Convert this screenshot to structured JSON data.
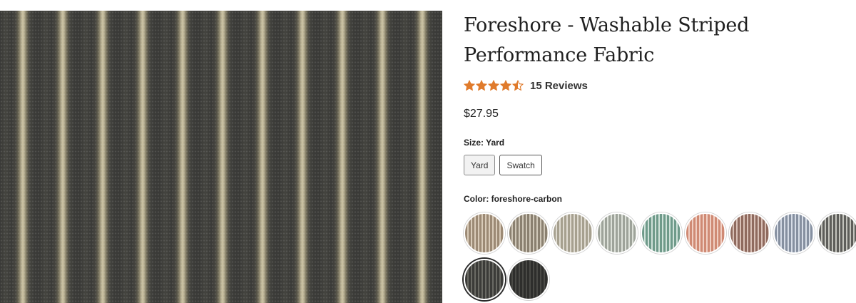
{
  "product": {
    "title": "Foreshore - Washable Striped Performance Fabric",
    "rating": 4.5,
    "reviews_label": "15 Reviews",
    "price": "$27.95"
  },
  "size": {
    "label": "Size: Yard",
    "options": [
      "Yard",
      "Swatch"
    ],
    "selected": "Yard"
  },
  "color": {
    "label": "Color: foreshore-carbon",
    "selected_index": 9,
    "swatches": [
      {
        "name": "tan",
        "base": "#9c8a75",
        "stripe": "#d9cbb9"
      },
      {
        "name": "taupe",
        "base": "#8a8070",
        "stripe": "#cfc7b8"
      },
      {
        "name": "stone",
        "base": "#a6a08f",
        "stripe": "#dedad0"
      },
      {
        "name": "sage-grey",
        "base": "#9ea39a",
        "stripe": "#dde1d9"
      },
      {
        "name": "seafoam",
        "base": "#6f9a8a",
        "stripe": "#cfe1d9"
      },
      {
        "name": "coral",
        "base": "#cf8a74",
        "stripe": "#f0cfc3"
      },
      {
        "name": "rust",
        "base": "#8f6a5e",
        "stripe": "#d8c0b6"
      },
      {
        "name": "slate-blue",
        "base": "#8690a0",
        "stripe": "#d6dce6"
      },
      {
        "name": "charcoal-stripe",
        "base": "#5e5e5a",
        "stripe": "#c4c4bd"
      },
      {
        "name": "carbon",
        "base": "#3b3b38",
        "stripe": "#6a6a64"
      },
      {
        "name": "black",
        "base": "#2e2e2c",
        "stripe": "#4a4a46"
      }
    ]
  },
  "colors": {
    "star": "#e07b2c",
    "text": "#222222"
  }
}
